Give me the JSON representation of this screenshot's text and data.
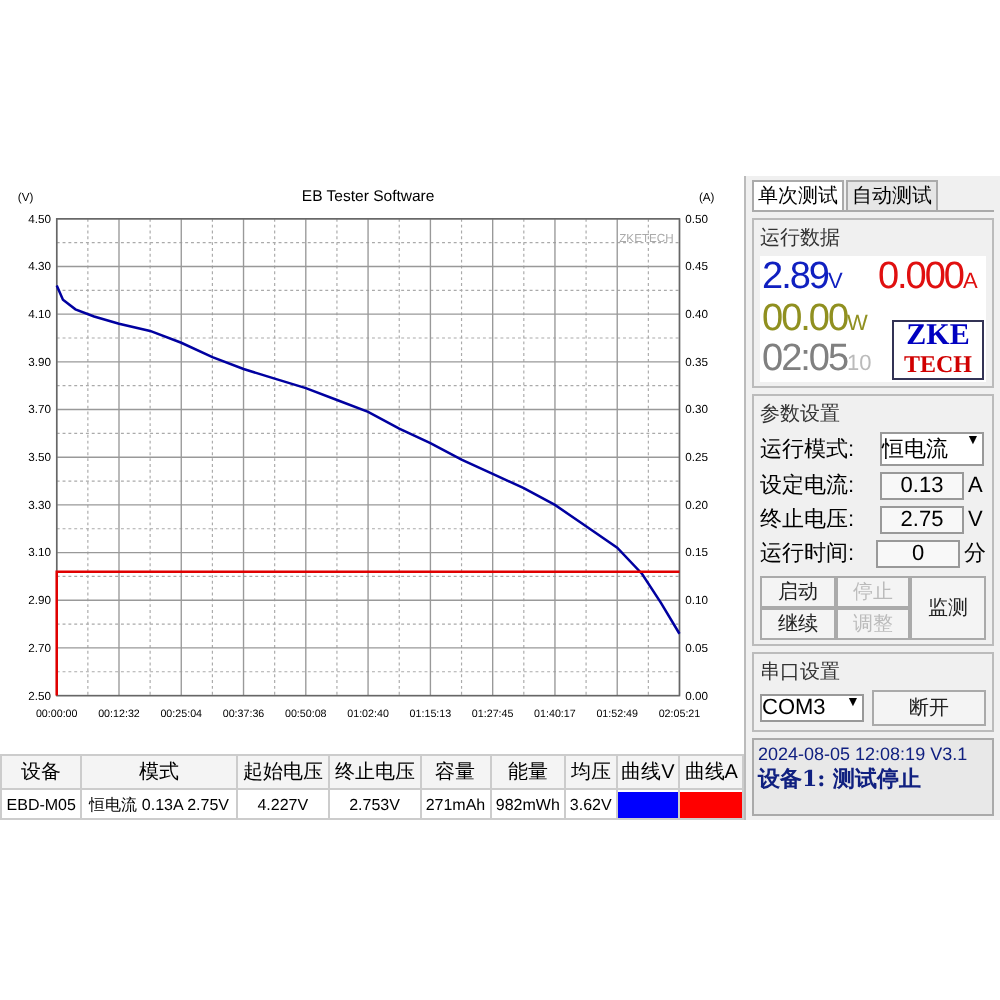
{
  "chart": {
    "brand": "ZKETECH",
    "chart_data": {
      "type": "line",
      "grid": true,
      "title": "EB Tester Software",
      "ylabel": "(V)",
      "y2label": "(A)",
      "x": [
        0,
        0,
        75,
        226,
        451,
        752,
        1128,
        1504,
        1880,
        2256,
        2632,
        3008,
        3384,
        3760,
        4137,
        4513,
        4889,
        5265,
        5641,
        6017,
        6393,
        6769,
        7070,
        7295,
        7521
      ],
      "xlim": [
        0,
        7521
      ],
      "ylim": [
        2.5,
        4.5
      ],
      "y2lim": [
        0,
        0.5
      ],
      "xticks": [
        {
          "value": 0,
          "label": "00:00:00"
        },
        {
          "value": 752,
          "label": "00:12:32"
        },
        {
          "value": 1504,
          "label": "00:25:04"
        },
        {
          "value": 2256,
          "label": "00:37:36"
        },
        {
          "value": 3008,
          "label": "00:50:08"
        },
        {
          "value": 3760,
          "label": "01:02:40"
        },
        {
          "value": 4513,
          "label": "01:15:13"
        },
        {
          "value": 5265,
          "label": "01:27:45"
        },
        {
          "value": 6017,
          "label": "01:40:17"
        },
        {
          "value": 6769,
          "label": "01:52:49"
        },
        {
          "value": 7521,
          "label": "02:05:21"
        }
      ],
      "yticks": [
        {
          "value": 2.5,
          "label": "2.50"
        },
        {
          "value": 2.7,
          "label": "2.70"
        },
        {
          "value": 2.9,
          "label": "2.90"
        },
        {
          "value": 3.1,
          "label": "3.10"
        },
        {
          "value": 3.3,
          "label": "3.30"
        },
        {
          "value": 3.5,
          "label": "3.50"
        },
        {
          "value": 3.7,
          "label": "3.70"
        },
        {
          "value": 3.9,
          "label": "3.90"
        },
        {
          "value": 4.1,
          "label": "4.10"
        },
        {
          "value": 4.3,
          "label": "4.30"
        },
        {
          "value": 4.5,
          "label": "4.50"
        }
      ],
      "y2ticks": [
        {
          "value": 0,
          "label": "0.00"
        },
        {
          "value": 0.05,
          "label": "0.05"
        },
        {
          "value": 0.1,
          "label": "0.10"
        },
        {
          "value": 0.15,
          "label": "0.15"
        },
        {
          "value": 0.2,
          "label": "0.20"
        },
        {
          "value": 0.25,
          "label": "0.25"
        },
        {
          "value": 0.3,
          "label": "0.30"
        },
        {
          "value": 0.35,
          "label": "0.35"
        },
        {
          "value": 0.4,
          "label": "0.40"
        },
        {
          "value": 0.45,
          "label": "0.45"
        },
        {
          "value": 0.5,
          "label": "0.50"
        }
      ],
      "series": [
        {
          "color": "#0000a0",
          "values": [
            4.22,
            4.22,
            4.16,
            4.12,
            4.09,
            4.06,
            4.03,
            3.98,
            3.92,
            3.87,
            3.83,
            3.79,
            3.74,
            3.69,
            3.62,
            3.56,
            3.49,
            3.43,
            3.37,
            3.3,
            3.21,
            3.12,
            3.01,
            2.89,
            2.76
          ]
        },
        {
          "color": "#e00000",
          "axis": "y2",
          "values": [
            0,
            0.13,
            0.13,
            0.13,
            0.13,
            0.13,
            0.13,
            0.13,
            0.13,
            0.13,
            0.13,
            0.13,
            0.13,
            0.13,
            0.13,
            0.13,
            0.13,
            0.13,
            0.13,
            0.13,
            0.13,
            0.13,
            0.13,
            0.13,
            0.13
          ]
        }
      ]
    }
  },
  "table": {
    "columns": [
      "设备",
      "模式",
      "起始电压",
      "终止电压",
      "容量",
      "能量",
      "均压",
      "曲线V",
      "曲线A"
    ],
    "rows": [
      {
        "cells": [
          "EBD-M05",
          "恒电流 0.13A 2.75V",
          "4.227V",
          "2.753V",
          "271mAh",
          "982mWh",
          "3.62V"
        ],
        "swatches": [
          {
            "color": "#0000ff"
          },
          {
            "color": "#ff0000"
          }
        ]
      }
    ]
  },
  "tabs": [
    {
      "label": "单次测试",
      "selected": true
    },
    {
      "label": "自动测试",
      "selected": false
    }
  ],
  "run_data": {
    "title": "运行数据",
    "voltage": "2.89",
    "voltage_unit": "V",
    "current": "0.000",
    "current_unit": "A",
    "power": "00.00",
    "power_unit": "W",
    "time": "02:05",
    "seconds": "10",
    "logo_top": "ZKE",
    "logo_bottom": "TECH"
  },
  "params": {
    "title": "参数设置",
    "fields": [
      {
        "kind": "select",
        "label": "运行模式:",
        "value": "恒电流",
        "caret": "▼"
      },
      {
        "kind": "input",
        "label": "设定电流:",
        "value": "0.13",
        "unit": "A"
      },
      {
        "kind": "input",
        "label": "终止电压:",
        "value": "2.75",
        "unit": "V"
      },
      {
        "kind": "input",
        "label": "运行时间:",
        "value": "0",
        "unit": "分"
      }
    ],
    "buttons": [
      {
        "label": "启动",
        "disabled": false
      },
      {
        "label": "停止",
        "disabled": true
      },
      {
        "label": "继续",
        "disabled": false
      },
      {
        "label": "调整",
        "disabled": true
      }
    ],
    "monitor": "监测"
  },
  "serial": {
    "title": "串口设置",
    "port": "COM3",
    "caret": "▼",
    "button": "断开"
  },
  "status": {
    "line1": "2024-08-05 12:08:19  V3.1",
    "line2": "设备1: 测试停止"
  }
}
